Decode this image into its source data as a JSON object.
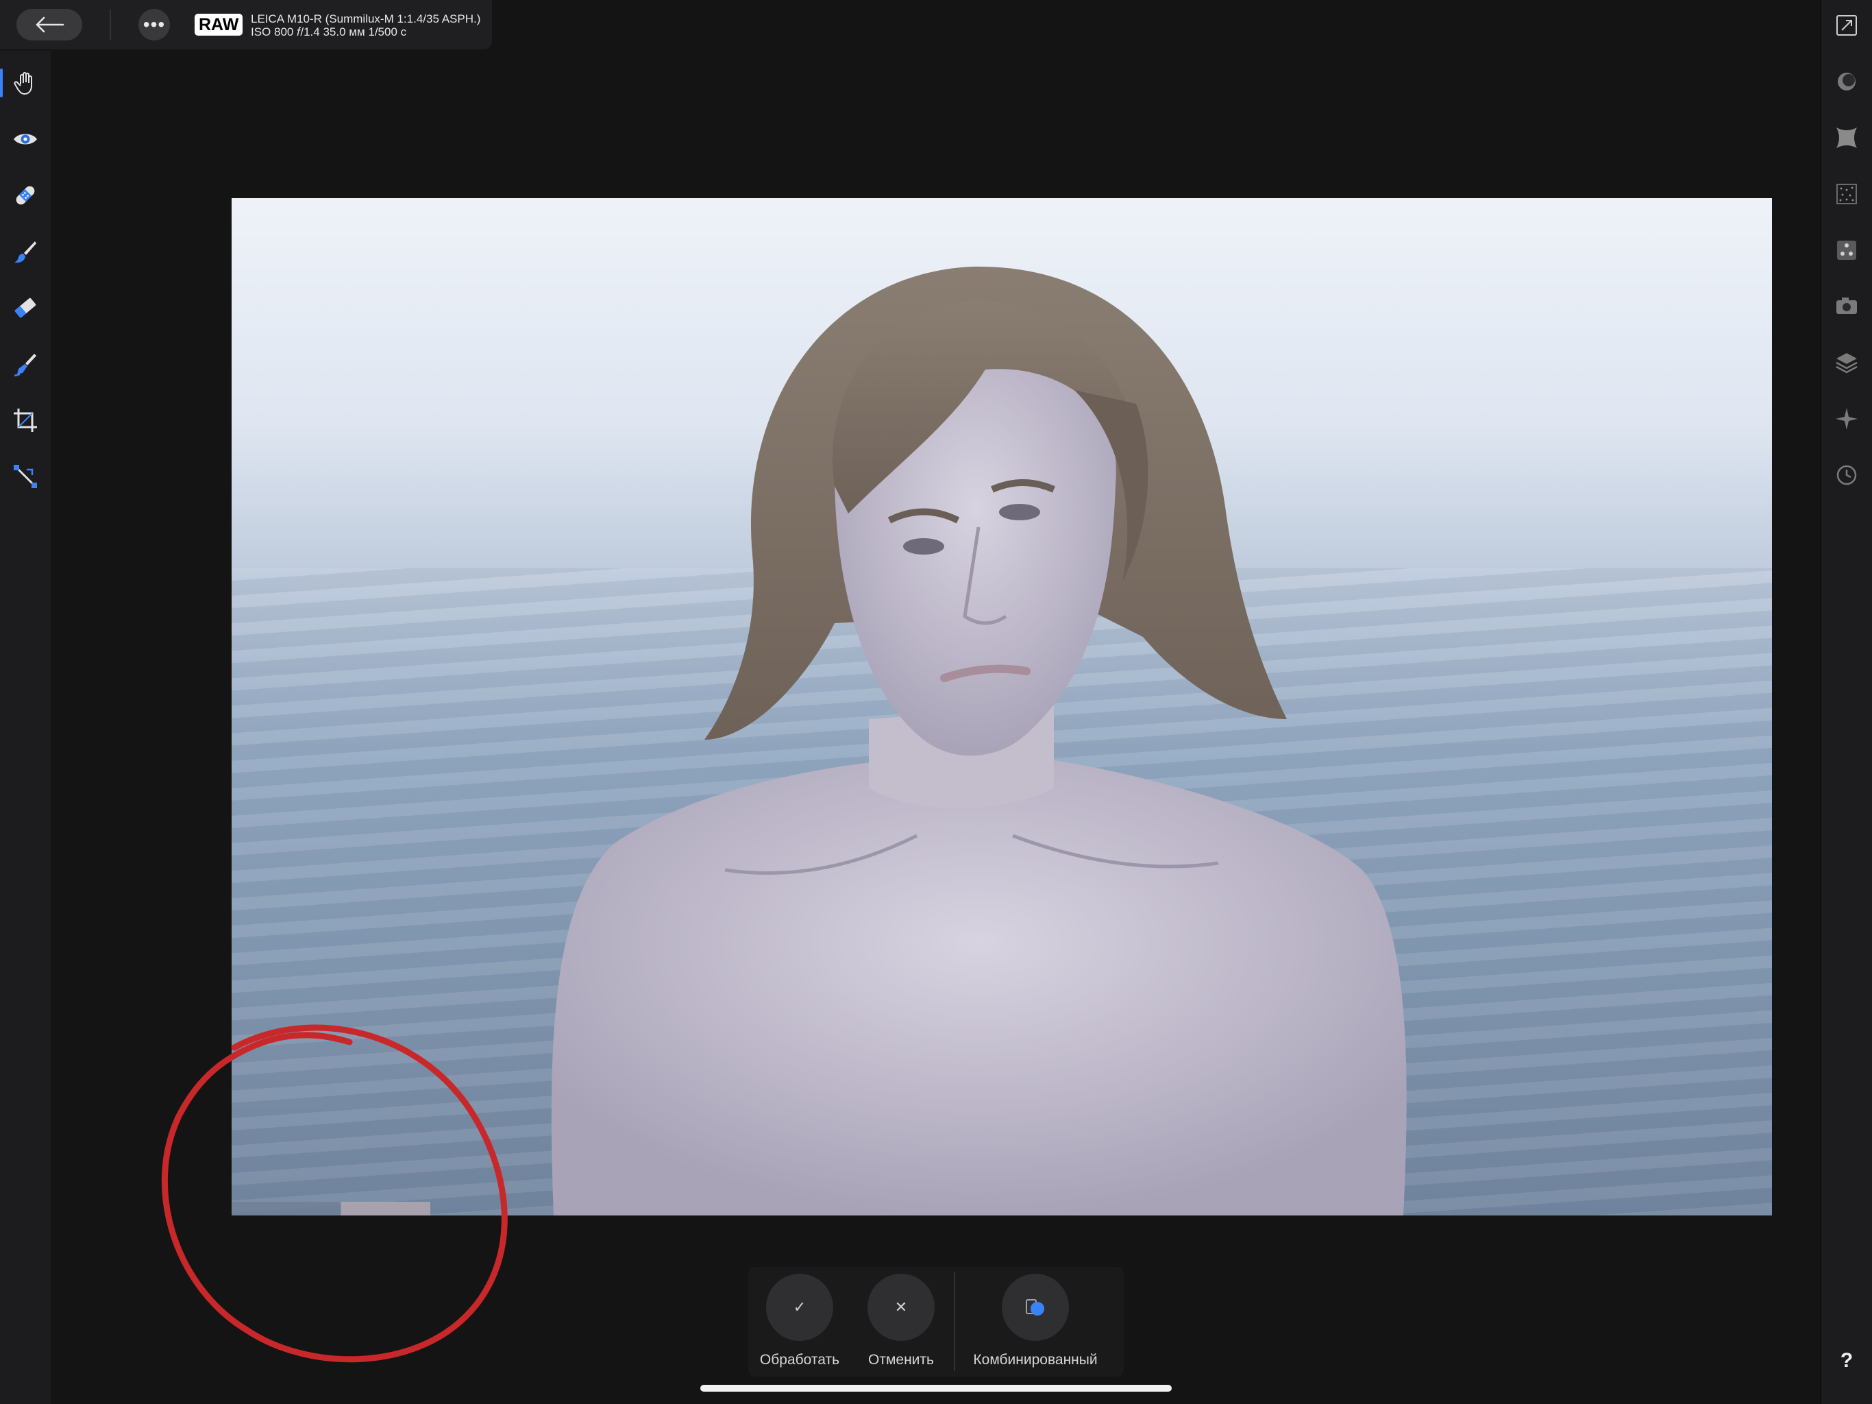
{
  "header": {
    "badge": "RAW",
    "camera_line": "LEICA M10-R (Summilux-M 1:1.4/35 ASPH.)",
    "exposure_line": "ISO 800 𝑓/1.4 35.0 мм 1/500 с",
    "more_glyph": "•••"
  },
  "left_toolbar": {
    "tools": [
      {
        "name": "hand-tool",
        "icon": "hand-icon",
        "active": true
      },
      {
        "name": "view-tool",
        "icon": "eye-icon"
      },
      {
        "name": "repair-tool",
        "icon": "bandage-icon"
      },
      {
        "name": "brush-tool",
        "icon": "paintbrush-icon"
      },
      {
        "name": "erase-tool",
        "icon": "eraser-icon"
      },
      {
        "name": "gradient-tool",
        "icon": "gradient-brush-icon"
      },
      {
        "name": "crop-tool",
        "icon": "crop-icon"
      },
      {
        "name": "transform-tool",
        "icon": "transform-icon"
      }
    ]
  },
  "right_toolbar": {
    "icons": [
      "fullscreen-icon",
      "circle-icon",
      "vignette-icon",
      "noise-icon",
      "dots-icon",
      "camera-icon",
      "layers-icon",
      "compass-icon",
      "history-icon"
    ],
    "help_label": "?"
  },
  "actions": {
    "apply": {
      "label": "Обработать",
      "glyph": "✓"
    },
    "cancel": {
      "label": "Отменить",
      "glyph": "✕"
    },
    "combined": {
      "label": "Комбинированный"
    }
  },
  "colors": {
    "accent": "#3a82f6",
    "annotation": "#c8282a",
    "background": "#141414"
  }
}
